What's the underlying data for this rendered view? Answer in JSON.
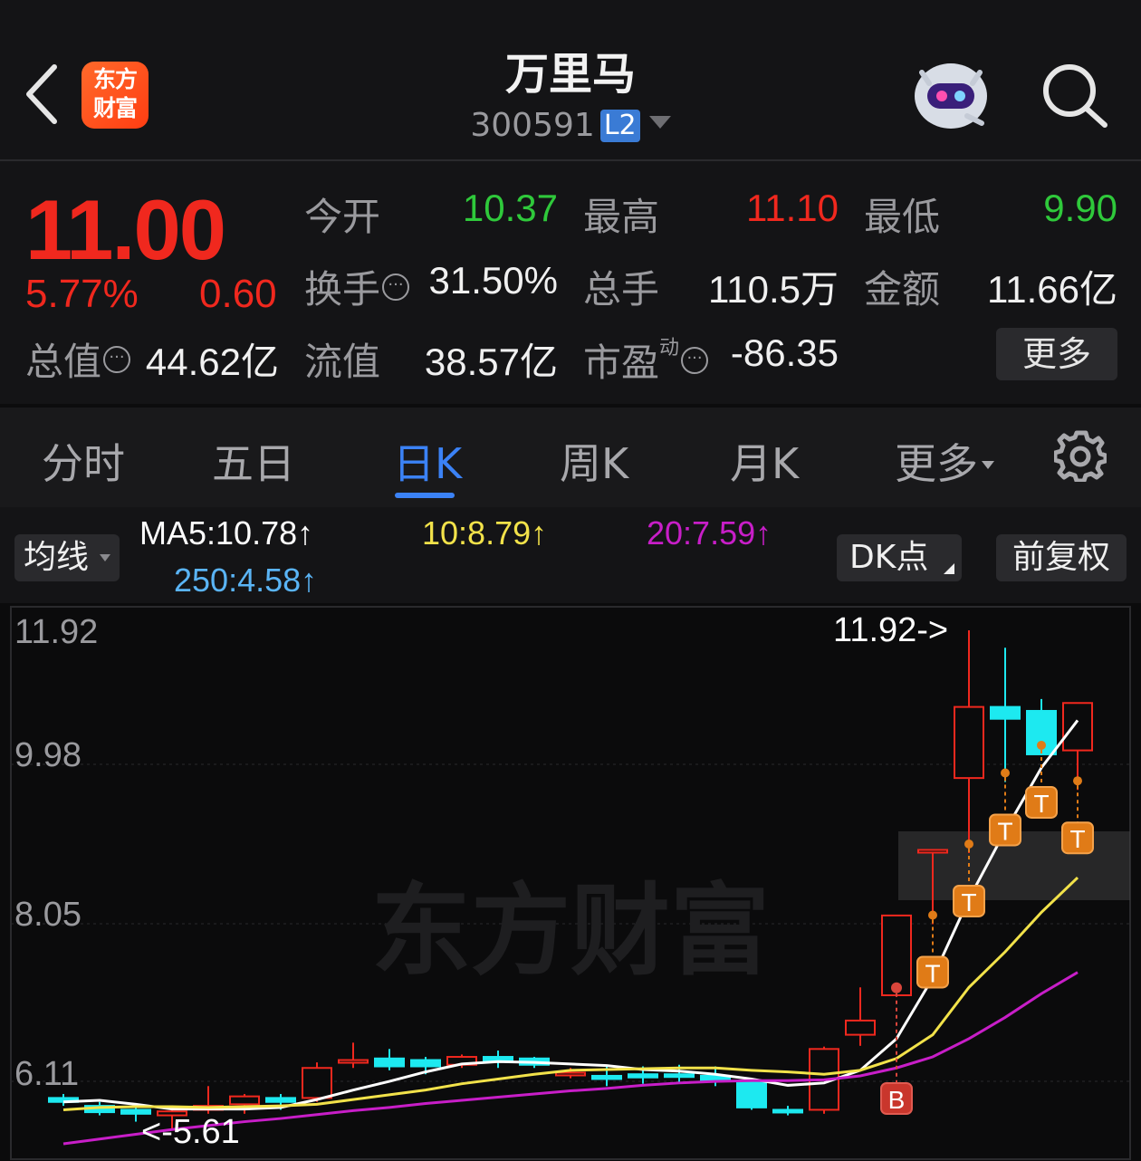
{
  "header": {
    "logo_line1": "东方",
    "logo_line2": "财富",
    "stock_name": "万里马",
    "stock_code": "300591",
    "level_badge": "L2"
  },
  "quote": {
    "price": "11.00",
    "change_pct": "5.77%",
    "change_amt": "0.60",
    "open_label": "今开",
    "open": "10.37",
    "high_label": "最高",
    "high": "11.10",
    "low_label": "最低",
    "low": "9.90",
    "turnover_label": "换手",
    "turnover": "31.50%",
    "volume_label": "总手",
    "volume": "110.5万",
    "amount_label": "金额",
    "amount": "11.66亿",
    "mktcap_label": "总值",
    "mktcap": "44.62亿",
    "float_label": "流值",
    "float_cap": "38.57亿",
    "pe_label": "市盈",
    "pe_sup": "动",
    "pe": "-86.35",
    "more_label": "更多"
  },
  "tabs": [
    {
      "label": "分时"
    },
    {
      "label": "五日"
    },
    {
      "label": "日K"
    },
    {
      "label": "周K"
    },
    {
      "label": "月K"
    },
    {
      "label": "更多"
    }
  ],
  "toolbar": {
    "ma_label": "均线",
    "ma5": "MA5:10.78↑",
    "ma10": "10:8.79↑",
    "ma20": "20:7.59↑",
    "ma250": "250:4.58↑",
    "dk_label": "DK点",
    "adjust_label": "前复权"
  },
  "colors": {
    "up": "#f0281e",
    "down": "#1de9f0",
    "ma5": "#ffffff",
    "ma10": "#f2e24a",
    "ma20": "#c81ec8",
    "ma250": "#5ab4f5",
    "signal": "#e07b17",
    "accent": "#3b82f6"
  },
  "chart_data": {
    "type": "candlestick",
    "y_axis_labels": [
      "11.92",
      "9.98",
      "8.05",
      "6.11"
    ],
    "ylim": [
      5.4,
      11.92
    ],
    "max_annotation": "11.92->",
    "min_annotation": "<-5.61",
    "watermark": "东方财富",
    "candles": [
      {
        "o": 6.0,
        "h": 6.05,
        "l": 5.9,
        "c": 5.95
      },
      {
        "o": 5.9,
        "h": 5.95,
        "l": 5.78,
        "c": 5.82
      },
      {
        "o": 5.85,
        "h": 5.92,
        "l": 5.7,
        "c": 5.8
      },
      {
        "o": 5.78,
        "h": 5.85,
        "l": 5.61,
        "c": 5.83
      },
      {
        "o": 5.85,
        "h": 6.15,
        "l": 5.8,
        "c": 5.9
      },
      {
        "o": 5.92,
        "h": 6.05,
        "l": 5.8,
        "c": 6.02
      },
      {
        "o": 6.0,
        "h": 6.05,
        "l": 5.85,
        "c": 5.95
      },
      {
        "o": 6.0,
        "h": 6.45,
        "l": 5.95,
        "c": 6.38
      },
      {
        "o": 6.45,
        "h": 6.7,
        "l": 6.38,
        "c": 6.48
      },
      {
        "o": 6.5,
        "h": 6.62,
        "l": 6.35,
        "c": 6.4
      },
      {
        "o": 6.48,
        "h": 6.52,
        "l": 6.3,
        "c": 6.4
      },
      {
        "o": 6.42,
        "h": 6.55,
        "l": 6.38,
        "c": 6.52
      },
      {
        "o": 6.52,
        "h": 6.6,
        "l": 6.38,
        "c": 6.47
      },
      {
        "o": 6.5,
        "h": 6.52,
        "l": 6.38,
        "c": 6.42
      },
      {
        "o": 6.3,
        "h": 6.38,
        "l": 6.25,
        "c": 6.32
      },
      {
        "o": 6.28,
        "h": 6.4,
        "l": 6.15,
        "c": 6.24
      },
      {
        "o": 6.3,
        "h": 6.4,
        "l": 6.18,
        "c": 6.26
      },
      {
        "o": 6.3,
        "h": 6.42,
        "l": 6.2,
        "c": 6.27
      },
      {
        "o": 6.28,
        "h": 6.4,
        "l": 6.15,
        "c": 6.22
      },
      {
        "o": 6.2,
        "h": 6.25,
        "l": 5.85,
        "c": 5.88
      },
      {
        "o": 5.85,
        "h": 5.9,
        "l": 5.78,
        "c": 5.84
      },
      {
        "o": 5.85,
        "h": 6.65,
        "l": 5.8,
        "c": 6.62
      },
      {
        "o": 6.8,
        "h": 7.4,
        "l": 6.66,
        "c": 6.98
      },
      {
        "o": 7.3,
        "h": 8.31,
        "l": 7.28,
        "c": 8.31
      },
      {
        "o": 9.14,
        "h": 9.14,
        "l": 8.2,
        "c": 9.14
      },
      {
        "o": 10.05,
        "h": 11.92,
        "l": 9.1,
        "c": 10.95
      },
      {
        "o": 10.95,
        "h": 11.7,
        "l": 10.0,
        "c": 10.8
      },
      {
        "o": 10.9,
        "h": 11.05,
        "l": 10.35,
        "c": 10.35
      },
      {
        "o": 10.4,
        "h": 10.9,
        "l": 9.9,
        "c": 11.0
      }
    ],
    "series": [
      {
        "name": "MA5",
        "values": [
          5.95,
          5.97,
          5.92,
          5.86,
          5.86,
          5.86,
          5.88,
          5.98,
          6.1,
          6.21,
          6.33,
          6.43,
          6.46,
          6.45,
          6.43,
          6.41,
          6.36,
          6.34,
          6.3,
          6.24,
          6.16,
          6.19,
          6.35,
          6.75,
          7.52,
          8.52,
          9.38,
          10.18,
          10.78
        ]
      },
      {
        "name": "MA10",
        "values": [
          5.85,
          5.88,
          5.89,
          5.89,
          5.88,
          5.89,
          5.9,
          5.92,
          5.98,
          6.04,
          6.1,
          6.18,
          6.24,
          6.3,
          6.35,
          6.36,
          6.37,
          6.38,
          6.38,
          6.35,
          6.33,
          6.3,
          6.35,
          6.5,
          6.8,
          7.4,
          7.85,
          8.35,
          8.79
        ]
      },
      {
        "name": "MA20",
        "values": [
          5.42,
          5.48,
          5.54,
          5.6,
          5.65,
          5.7,
          5.74,
          5.79,
          5.84,
          5.88,
          5.93,
          5.97,
          6.01,
          6.05,
          6.09,
          6.12,
          6.16,
          6.19,
          6.21,
          6.22,
          6.22,
          6.23,
          6.28,
          6.38,
          6.52,
          6.75,
          7.02,
          7.32,
          7.59
        ]
      }
    ],
    "dk_signals": [
      {
        "index": 23,
        "type": "B"
      },
      {
        "index": 24,
        "type": "T"
      },
      {
        "index": 25,
        "type": "T"
      },
      {
        "index": 26,
        "type": "T"
      },
      {
        "index": 27,
        "type": "T"
      },
      {
        "index": 28,
        "type": "T"
      }
    ]
  }
}
